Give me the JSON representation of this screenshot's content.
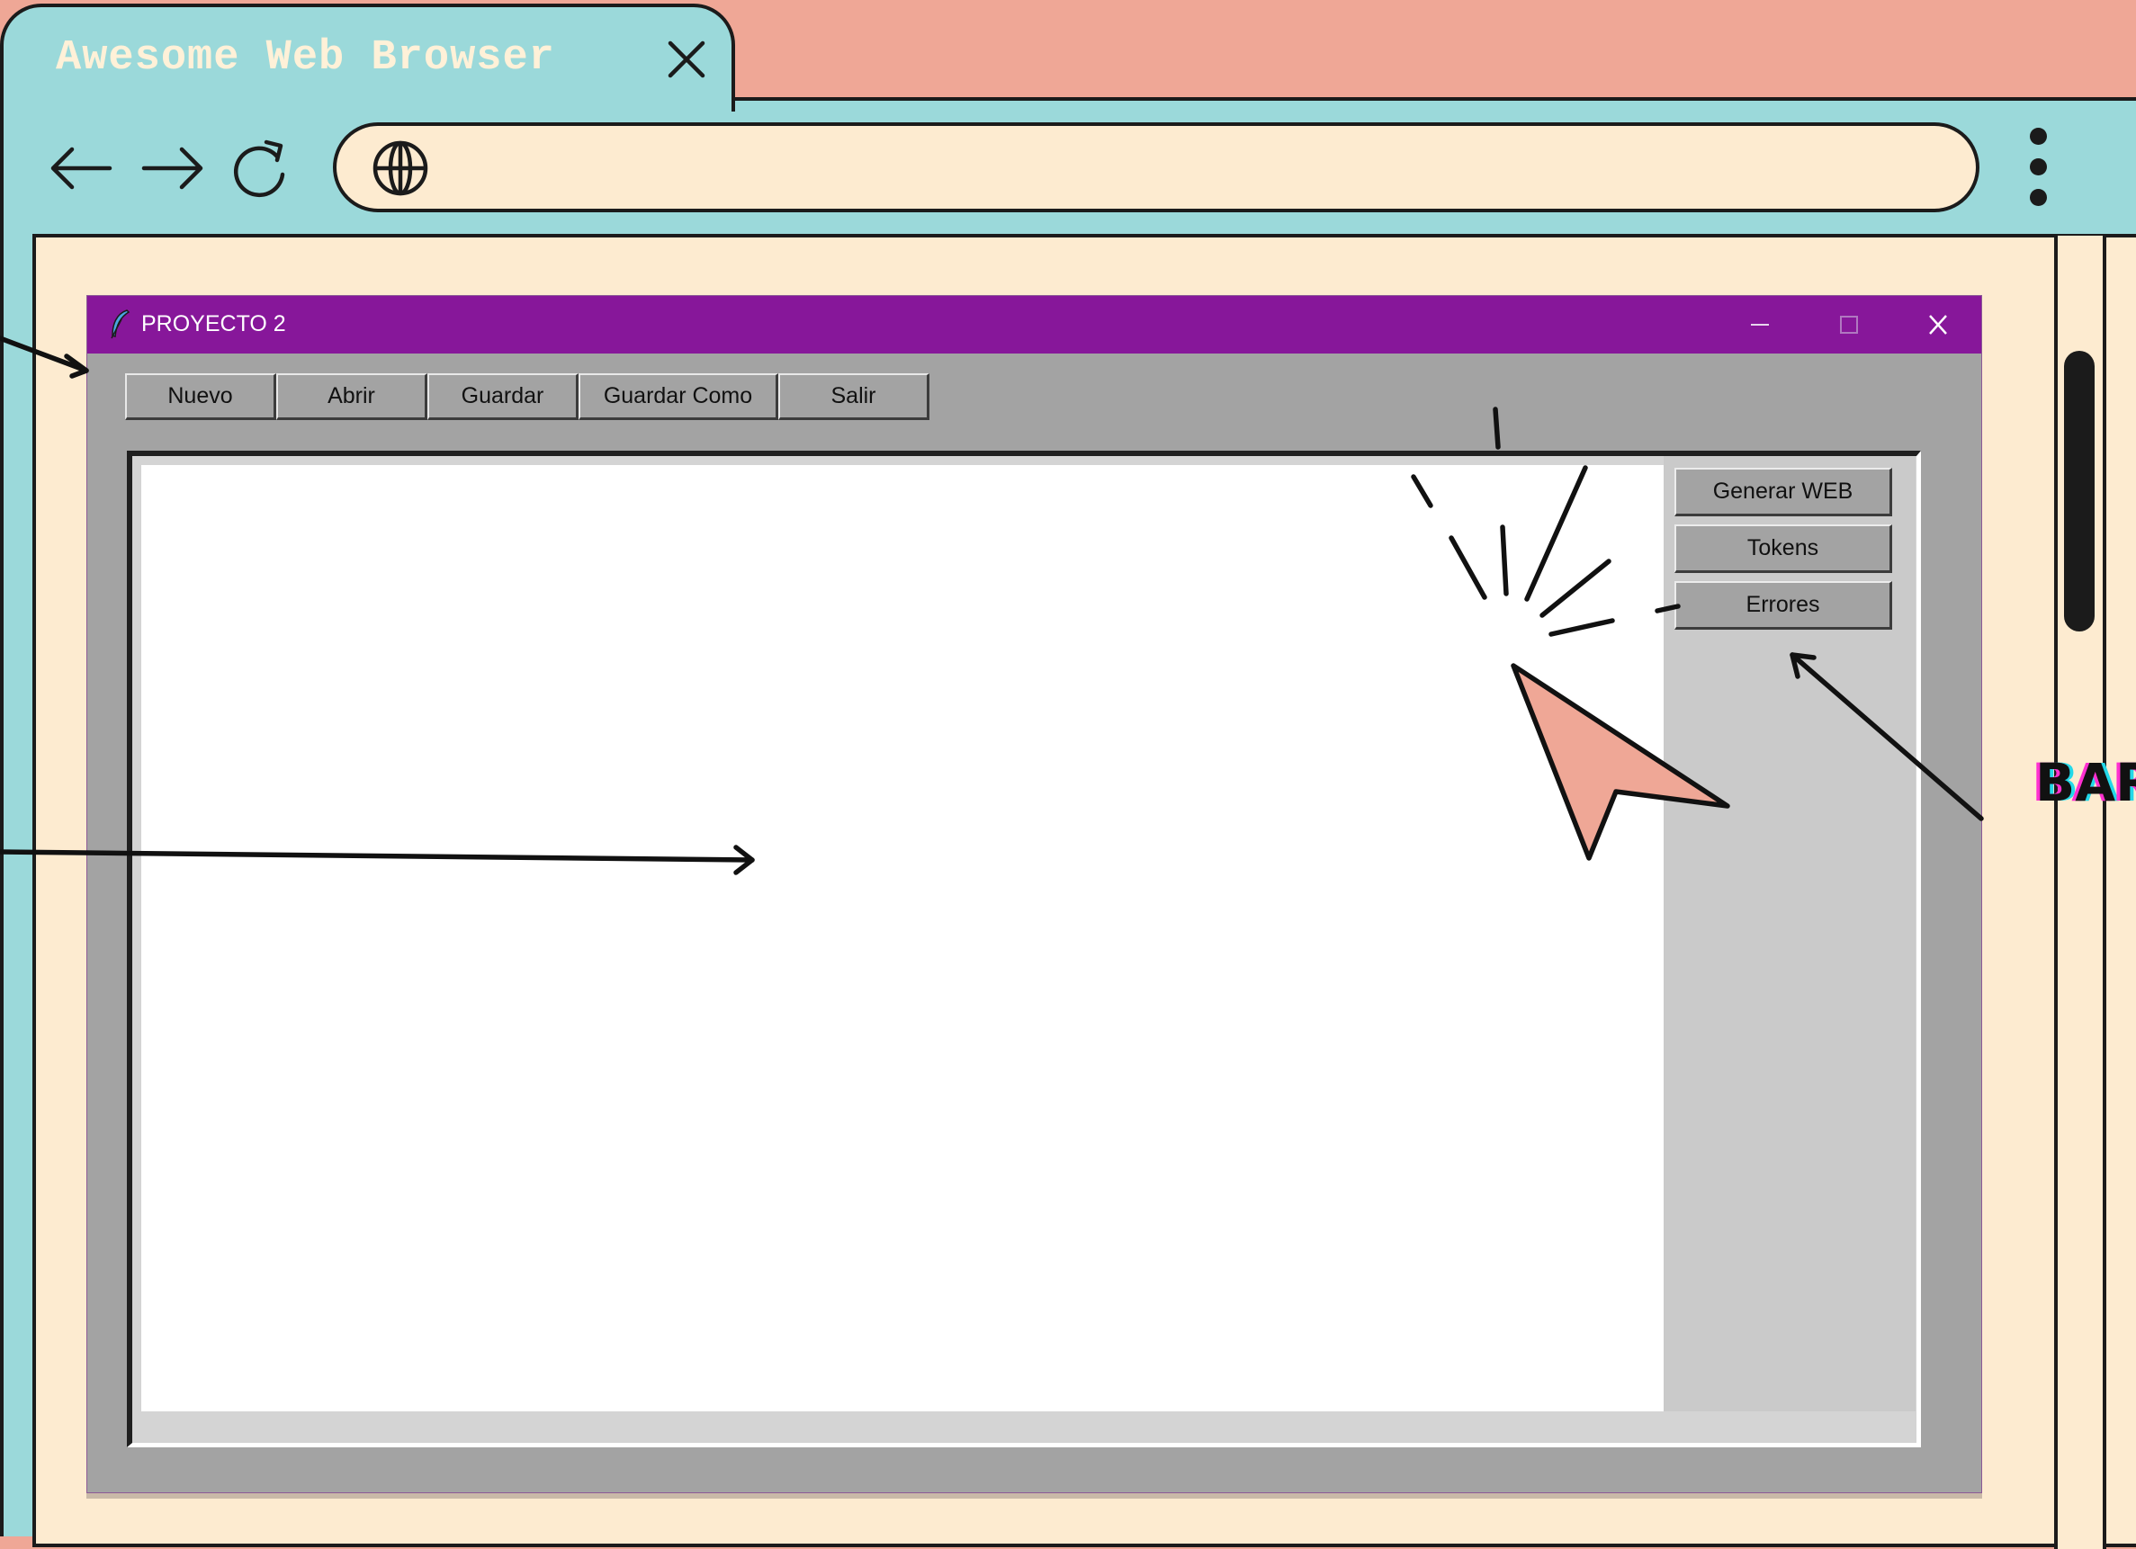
{
  "browser": {
    "tab_title": "Awesome Web Browser",
    "icons": {
      "tab_close": "close-icon",
      "back": "arrow-left-icon",
      "forward": "arrow-right-icon",
      "reload": "reload-icon",
      "address": "globe-icon",
      "menu": "kebab-menu-icon"
    },
    "address_value": ""
  },
  "app": {
    "title": "PROYECTO 2",
    "title_icon": "feather-icon",
    "toolbar": [
      "Nuevo",
      "Abrir",
      "Guardar",
      "Guardar Como",
      "Salir"
    ],
    "side_buttons": [
      "Generar WEB",
      "Tokens",
      "Errores"
    ],
    "editor_text": ""
  },
  "annotation": {
    "side_label": "BAR"
  },
  "colors": {
    "page_bg": "#efa796",
    "chrome": "#9bd9da",
    "viewport": "#fdebd0",
    "app_titlebar": "#87179a",
    "app_body": "#a3a3a3",
    "cursor_fill": "#efa796"
  }
}
